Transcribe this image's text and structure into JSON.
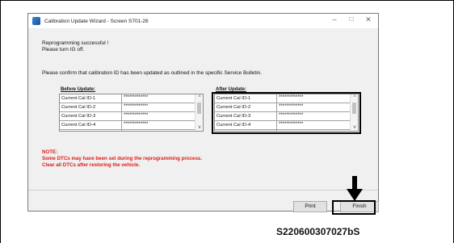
{
  "window": {
    "title": "Calibration Update Wizard - Screen S701-26",
    "controls": {
      "minimize": "–",
      "maximize": "□",
      "close": "✕"
    }
  },
  "messages": {
    "line1": "Reprogramming successful !",
    "line2": "Please turn IG off.",
    "confirm": "Please confirm that calibration ID has been updated as outlined in the specific Service Bulletin."
  },
  "before": {
    "label": "Before Update:",
    "rows": [
      {
        "name": "Current Cal ID-1",
        "value": "*************"
      },
      {
        "name": "Current Cal ID-2",
        "value": "*************"
      },
      {
        "name": "Current Cal ID-3",
        "value": "*************"
      },
      {
        "name": "Current Cal ID-4",
        "value": "*************"
      }
    ]
  },
  "after": {
    "label": "After Update:",
    "rows": [
      {
        "name": "Current Cal ID-1",
        "value": "*************"
      },
      {
        "name": "Current Cal ID-2",
        "value": "*************"
      },
      {
        "name": "Current Cal ID-3",
        "value": "*************"
      },
      {
        "name": "Current Cal ID-4",
        "value": "*************"
      }
    ]
  },
  "note": {
    "title": "NOTE:",
    "line1": "Some DTCs may have been set during the reprogramming process.",
    "line2": "Clear all DTCs after restoring the vehicle."
  },
  "buttons": {
    "print": "Print",
    "finish": "Finish"
  },
  "scrollbar": {
    "up": "^",
    "down": "v"
  },
  "caption": "S220600307027bS",
  "colors": {
    "note": "#e01a1a",
    "highlight": "#000000"
  }
}
